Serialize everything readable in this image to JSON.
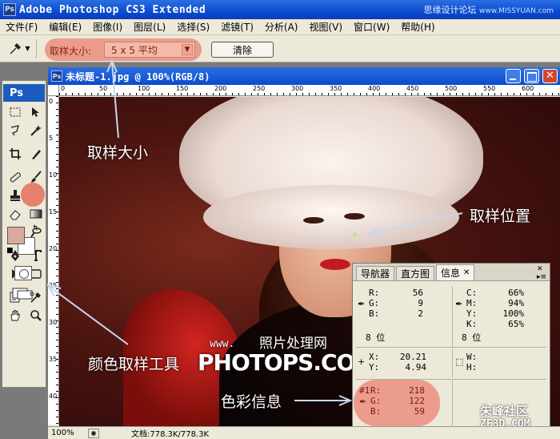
{
  "app": {
    "title": "Adobe Photoshop CS3 Extended",
    "ps_badge": "Ps",
    "watermark": "思缘设计论坛",
    "watermark_url": "www.MISSYUAN.com"
  },
  "menu": {
    "items": [
      "文件(F)",
      "编辑(E)",
      "图像(I)",
      "图层(L)",
      "选择(S)",
      "滤镜(T)",
      "分析(A)",
      "视图(V)",
      "窗口(W)",
      "帮助(H)"
    ]
  },
  "options": {
    "sample_label": "取样大小:",
    "sample_value": "5 x 5 平均",
    "clear_label": "清除"
  },
  "toolbox": {
    "logo": "Ps"
  },
  "document": {
    "title": "未标题-1.jpg @ 100%(RGB/8)",
    "ruler_top": [
      "0",
      "50",
      "100",
      "150",
      "200",
      "250",
      "300",
      "350",
      "400",
      "450",
      "500",
      "550",
      "600"
    ],
    "ruler_left": [
      "0",
      "5",
      "10",
      "15",
      "20",
      "25",
      "30",
      "35",
      "40"
    ]
  },
  "annotations": {
    "sample_size": "取样大小",
    "sample_position": "取样位置",
    "color_tool": "颜色取样工具",
    "color_info": "色彩信息",
    "wm_cn": "照片处理网",
    "wm_www": "www.",
    "wm_photops": "PHOTOPS.COM",
    "site_cn": "朱峰社区",
    "site_en": "ZF3D.COM"
  },
  "info_panel": {
    "tabs": [
      "导航器",
      "直方图",
      "信息"
    ],
    "rgb": [
      {
        "label": "R:",
        "value": "56"
      },
      {
        "label": "G:",
        "value": "9"
      },
      {
        "label": "B:",
        "value": "2"
      }
    ],
    "rgb_bits": "8 位",
    "cmyk": [
      {
        "label": "C:",
        "value": "66%"
      },
      {
        "label": "M:",
        "value": "94%"
      },
      {
        "label": "Y:",
        "value": "100%"
      },
      {
        "label": "K:",
        "value": "65%"
      }
    ],
    "cmyk_bits": "8 位",
    "xy": [
      {
        "label": "X:",
        "value": "20.21"
      },
      {
        "label": "Y:",
        "value": "4.94"
      }
    ],
    "wh": [
      {
        "label": "W:",
        "value": ""
      },
      {
        "label": "H:",
        "value": ""
      }
    ],
    "sampler_id": "#1",
    "sampler": [
      {
        "label": "R:",
        "value": "218"
      },
      {
        "label": "G:",
        "value": "122"
      },
      {
        "label": "B:",
        "value": "59"
      }
    ]
  },
  "status": {
    "zoom": "100%",
    "doc_size": "文档:778.3K/778.3K"
  },
  "colors": {
    "highlight": "#eb9c8c",
    "foreground_swatch": "#d9a9a0",
    "title_blue": "#0a4bd0"
  }
}
